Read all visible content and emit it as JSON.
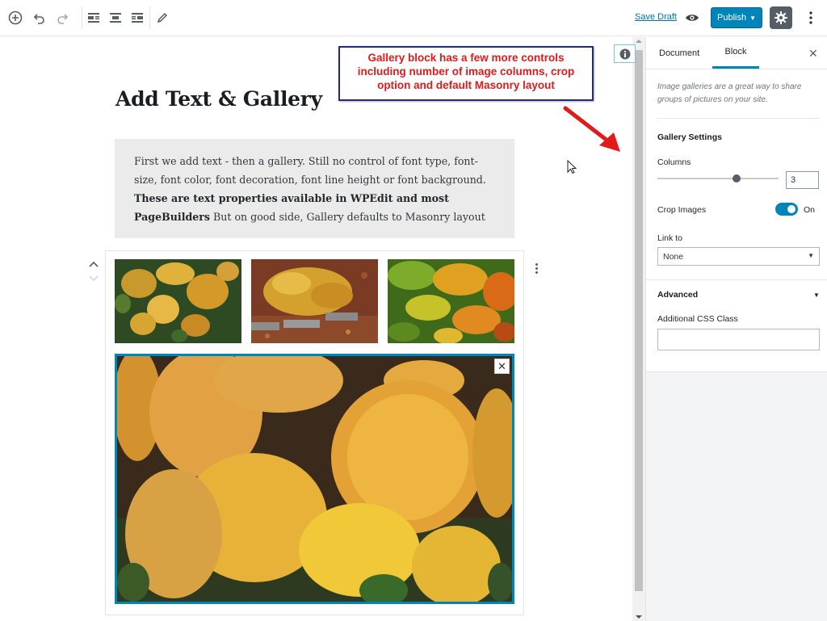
{
  "toolbar": {
    "icons": [
      "add-block-icon",
      "undo-icon",
      "redo-icon",
      "align-left-icon",
      "align-center-icon",
      "align-right-icon",
      "edit-pencil-icon",
      "preview-eye-icon",
      "settings-gear-icon",
      "more-options-icon"
    ],
    "save_draft_label": "Save Draft",
    "publish_label": "Publish",
    "publish_caret": "▼"
  },
  "colors": {
    "accent": "#0085ba",
    "annotation_text": "#e21a1a",
    "annotation_border": "#1e2a8a",
    "paragraph_bg": "#ebebeb"
  },
  "post": {
    "title": "Add Text & Gallery",
    "paragraph_plain": "First we add text - then a gallery. Still no control of font type, font-size, font color, font decoration, font line height or font background. ",
    "paragraph_bold": "These are text properties available in WPEdit and most PageBuilders",
    "paragraph_tail": " But on good side, Gallery defaults to Masonry layout"
  },
  "gallery": {
    "images": [
      "hosta-leaves-thumb-1",
      "hosta-leaves-thumb-2",
      "autumn-foliage-thumb-3",
      "hosta-leaves-large"
    ],
    "remove_label": "✕"
  },
  "annotation": {
    "text": "Gallery block has a few more controls including number of image columns, crop option and default Masonry layout"
  },
  "sidebar": {
    "tabs": [
      "Document",
      "Block"
    ],
    "active_tab": "Block",
    "close_label": "✕",
    "description": "Image galleries are a great way to share groups of pictures on your site.",
    "gallery_settings_heading": "Gallery Settings",
    "columns_label": "Columns",
    "columns_value": "3",
    "columns_slider_fraction": 0.65,
    "crop_label": "Crop Images",
    "crop_state": "On",
    "link_to_label": "Link to",
    "link_to_value": "None",
    "select_caret": "▼",
    "advanced_label": "Advanced",
    "advanced_caret": "▼",
    "css_class_label": "Additional CSS Class",
    "css_class_value": ""
  }
}
